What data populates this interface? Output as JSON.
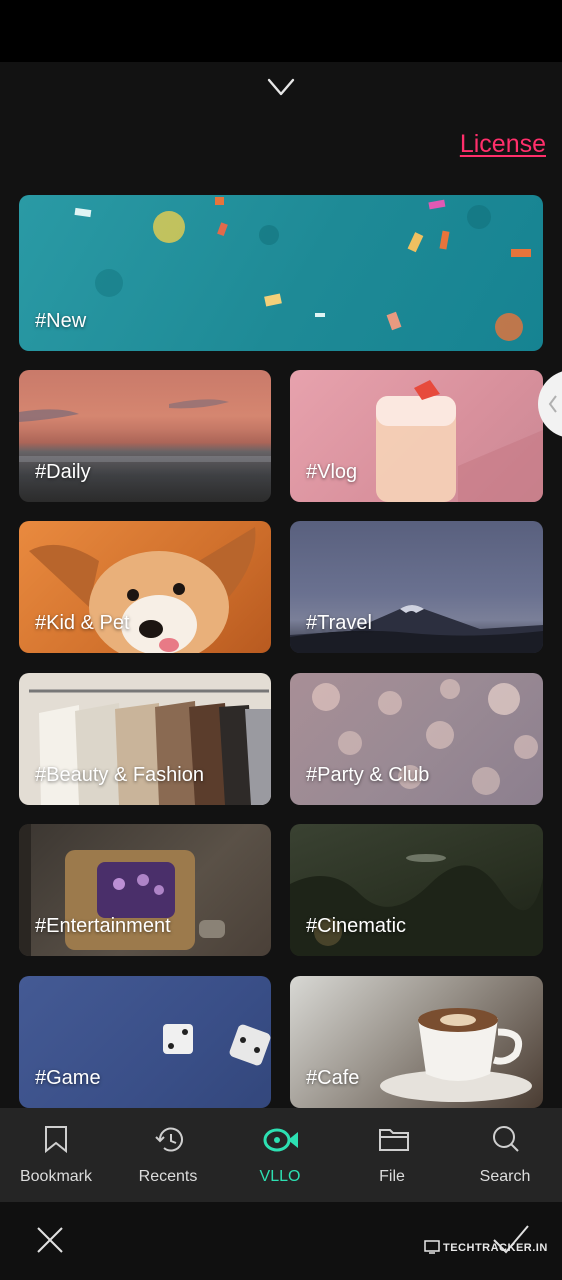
{
  "header": {
    "license_label": "License"
  },
  "categories": {
    "new": "#New",
    "daily": "#Daily",
    "vlog": "#Vlog",
    "kid_pet": "#Kid & Pet",
    "travel": "#Travel",
    "beauty_fashion": "#Beauty & Fashion",
    "party_club": "#Party & Club",
    "entertainment": "#Entertainment",
    "cinematic": "#Cinematic",
    "game": "#Game",
    "cafe": "#Cafe"
  },
  "nav": {
    "bookmark": "Bookmark",
    "recents": "Recents",
    "vllo": "VLLO",
    "file": "File",
    "search": "Search"
  },
  "colors": {
    "accent": "#2de0b2",
    "license": "#ff2f6b"
  },
  "watermark": "TECHTRACKER.IN"
}
